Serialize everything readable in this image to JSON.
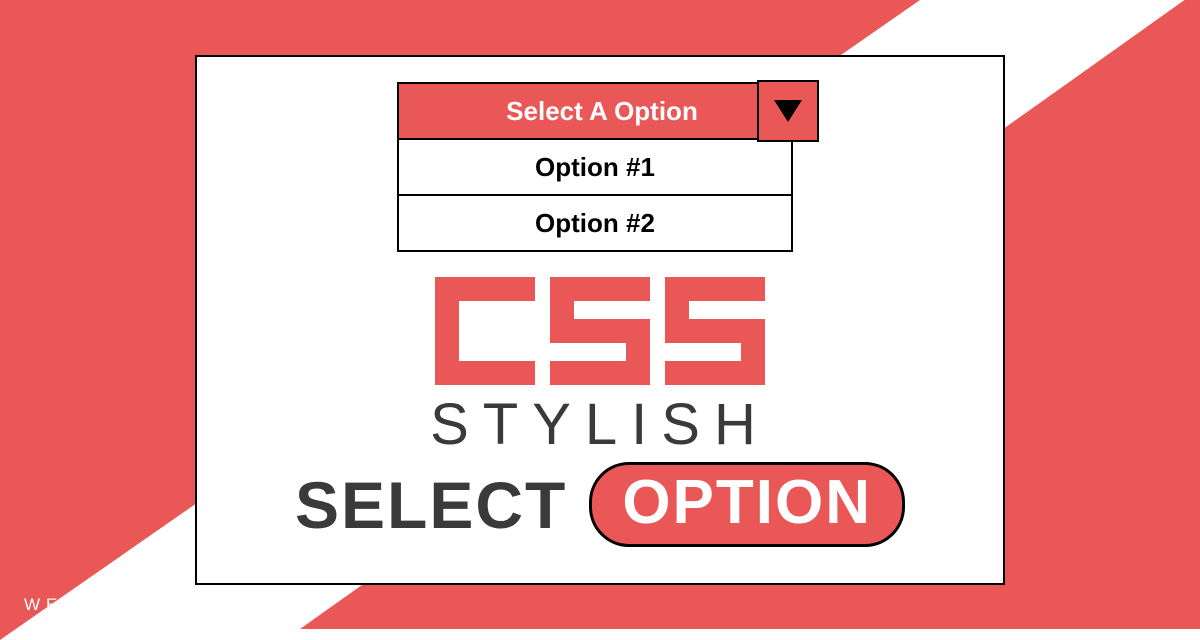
{
  "colors": {
    "accent": "#E95757",
    "dark": "#3A3A3A",
    "border": "#000000"
  },
  "dropdown": {
    "header_label": "Select A Option",
    "options": [
      "Option #1",
      "Option #2"
    ]
  },
  "title": {
    "css_word": "CSS",
    "stylish_word": "STYLISH",
    "select_word": "SELECT",
    "option_word": "OPTION"
  },
  "watermark": "WEBDEVTRICK.COM"
}
